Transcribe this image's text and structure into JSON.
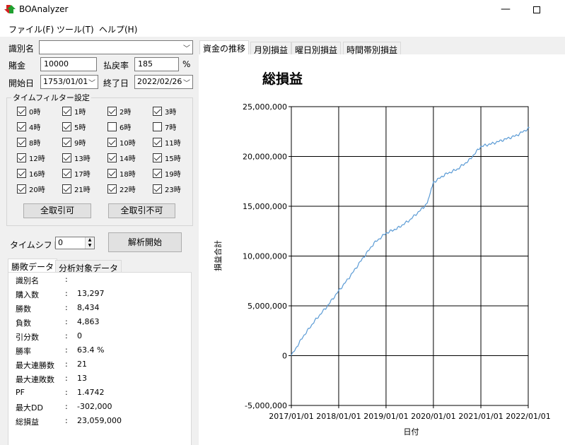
{
  "window": {
    "title": "BOAnalyzer",
    "minimize": "—",
    "maximize": ""
  },
  "menu": {
    "file": "ファイル(F)",
    "tools": "ツール(T)",
    "help": "ヘルプ(H)"
  },
  "form": {
    "id_label": "識別名",
    "id_value": "",
    "stake_label": "賭金",
    "stake_value": "10000",
    "payout_label": "払戻率",
    "payout_value": "185",
    "payout_unit": "%",
    "start_label": "開始日",
    "start_value": "1753/01/01",
    "end_label": "終了日",
    "end_value": "2022/02/26"
  },
  "time_filter": {
    "title": "タイムフィルター設定",
    "hours": [
      {
        "label": "0時",
        "checked": true
      },
      {
        "label": "1時",
        "checked": true
      },
      {
        "label": "2時",
        "checked": true
      },
      {
        "label": "3時",
        "checked": true
      },
      {
        "label": "4時",
        "checked": true
      },
      {
        "label": "5時",
        "checked": true
      },
      {
        "label": "6時",
        "checked": false
      },
      {
        "label": "7時",
        "checked": false
      },
      {
        "label": "8時",
        "checked": true
      },
      {
        "label": "9時",
        "checked": true
      },
      {
        "label": "10時",
        "checked": true
      },
      {
        "label": "11時",
        "checked": true
      },
      {
        "label": "12時",
        "checked": true
      },
      {
        "label": "13時",
        "checked": true
      },
      {
        "label": "14時",
        "checked": true
      },
      {
        "label": "15時",
        "checked": true
      },
      {
        "label": "16時",
        "checked": true
      },
      {
        "label": "17時",
        "checked": true
      },
      {
        "label": "18時",
        "checked": true
      },
      {
        "label": "19時",
        "checked": true
      },
      {
        "label": "20時",
        "checked": true
      },
      {
        "label": "21時",
        "checked": true
      },
      {
        "label": "22時",
        "checked": true
      },
      {
        "label": "23時",
        "checked": true
      }
    ],
    "allow_all": "全取引可",
    "deny_all": "全取引不可"
  },
  "timeshift": {
    "label": "タイムシフト",
    "value": "0"
  },
  "analyze_button": "解析開始",
  "left_tabs": {
    "stats": "勝敗データ",
    "target": "分析対象データ"
  },
  "stats": [
    {
      "label": "識別名",
      "value": ""
    },
    {
      "label": "購入数",
      "value": "13,297"
    },
    {
      "label": "勝数",
      "value": "8,434"
    },
    {
      "label": "負数",
      "value": "4,863"
    },
    {
      "label": "引分数",
      "value": "0"
    },
    {
      "label": "勝率",
      "value": "63.4 %"
    },
    {
      "label": "最大連勝数",
      "value": "21"
    },
    {
      "label": "最大連敗数",
      "value": "13"
    },
    {
      "label": "PF",
      "value": "1.4742"
    },
    {
      "label": "最大DD",
      "value": "-302,000"
    },
    {
      "label": "総損益",
      "value": "23,059,000"
    }
  ],
  "chart_tabs": [
    "資金の推移",
    "月別損益",
    "曜日別損益",
    "時間帯別損益"
  ],
  "chart_data": {
    "type": "line",
    "title": "総損益",
    "xlabel": "日付",
    "ylabel": "損益合計",
    "x_ticks": [
      "2017/01/01",
      "2018/01/01",
      "2019/01/01",
      "2020/01/01",
      "2021/01/01",
      "2022/01/01"
    ],
    "y_ticks": [
      "-5,000,000",
      "0",
      "5,000,000",
      "10,000,000",
      "15,000,000",
      "20,000,000",
      "25,000,000"
    ],
    "ylim": [
      -5000000,
      25000000
    ],
    "xlim": [
      "2017/01/01",
      "2022/01/01"
    ],
    "grid": true,
    "line_color": "#5b9bd5",
    "series": [
      {
        "x": [
          "2017/01/01",
          "2017/04/01",
          "2017/07/01",
          "2017/10/01",
          "2018/01/01",
          "2018/04/01",
          "2018/07/01",
          "2018/10/01",
          "2019/01/01",
          "2019/04/01",
          "2019/07/01",
          "2019/10/01",
          "2019/11/15",
          "2020/01/01",
          "2020/04/01",
          "2020/07/01",
          "2020/10/01",
          "2021/01/01",
          "2021/04/01",
          "2021/07/01",
          "2021/10/01",
          "2022/01/01",
          "2022/02/26"
        ],
        "values": [
          0,
          1900000,
          3500000,
          4900000,
          6500000,
          8000000,
          9700000,
          11300000,
          12300000,
          12800000,
          13600000,
          14700000,
          15300000,
          17400000,
          18200000,
          18700000,
          19600000,
          21000000,
          21300000,
          21700000,
          22100000,
          22800000,
          23059000
        ]
      }
    ]
  }
}
